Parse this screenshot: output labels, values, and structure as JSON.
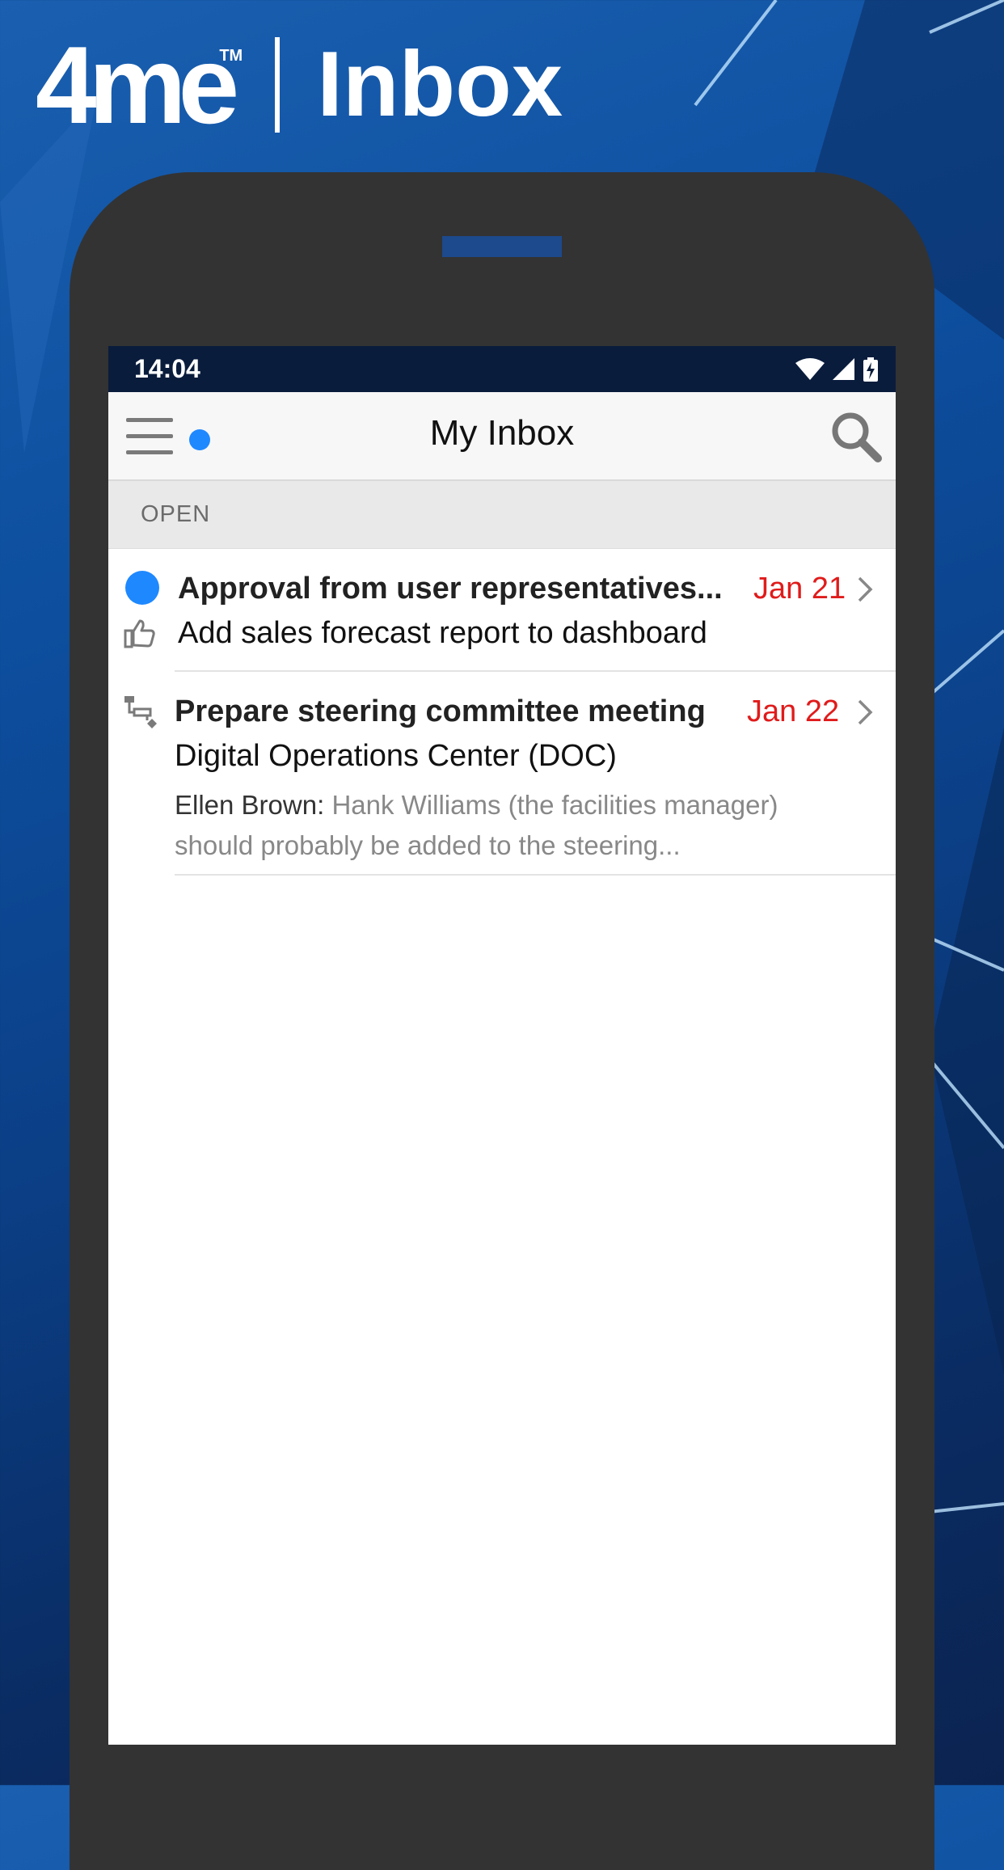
{
  "header": {
    "logo": "4me",
    "logo_tm": "TM",
    "title": "Inbox"
  },
  "status_bar": {
    "time": "14:04"
  },
  "app_bar": {
    "title": "My Inbox"
  },
  "section": {
    "label": "OPEN"
  },
  "items": [
    {
      "title": "Approval from user representatives...",
      "date": "Jan 21",
      "subtitle": "Add sales forecast report to dashboard",
      "unread": true,
      "icon": "thumbs-up-icon"
    },
    {
      "title": "Prepare steering committee meeting",
      "date": "Jan 22",
      "subtitle": "Digital Operations Center (DOC)",
      "author": "Ellen Brown:",
      "preview": "Hank Williams (the facilities manager) should probably be added to the steering...",
      "icon": "workflow-task-icon"
    }
  ],
  "colors": {
    "accent": "#1e88ff",
    "date": "#e01b1b",
    "status_bar": "#0a1c3c",
    "phone_body": "#333333"
  }
}
